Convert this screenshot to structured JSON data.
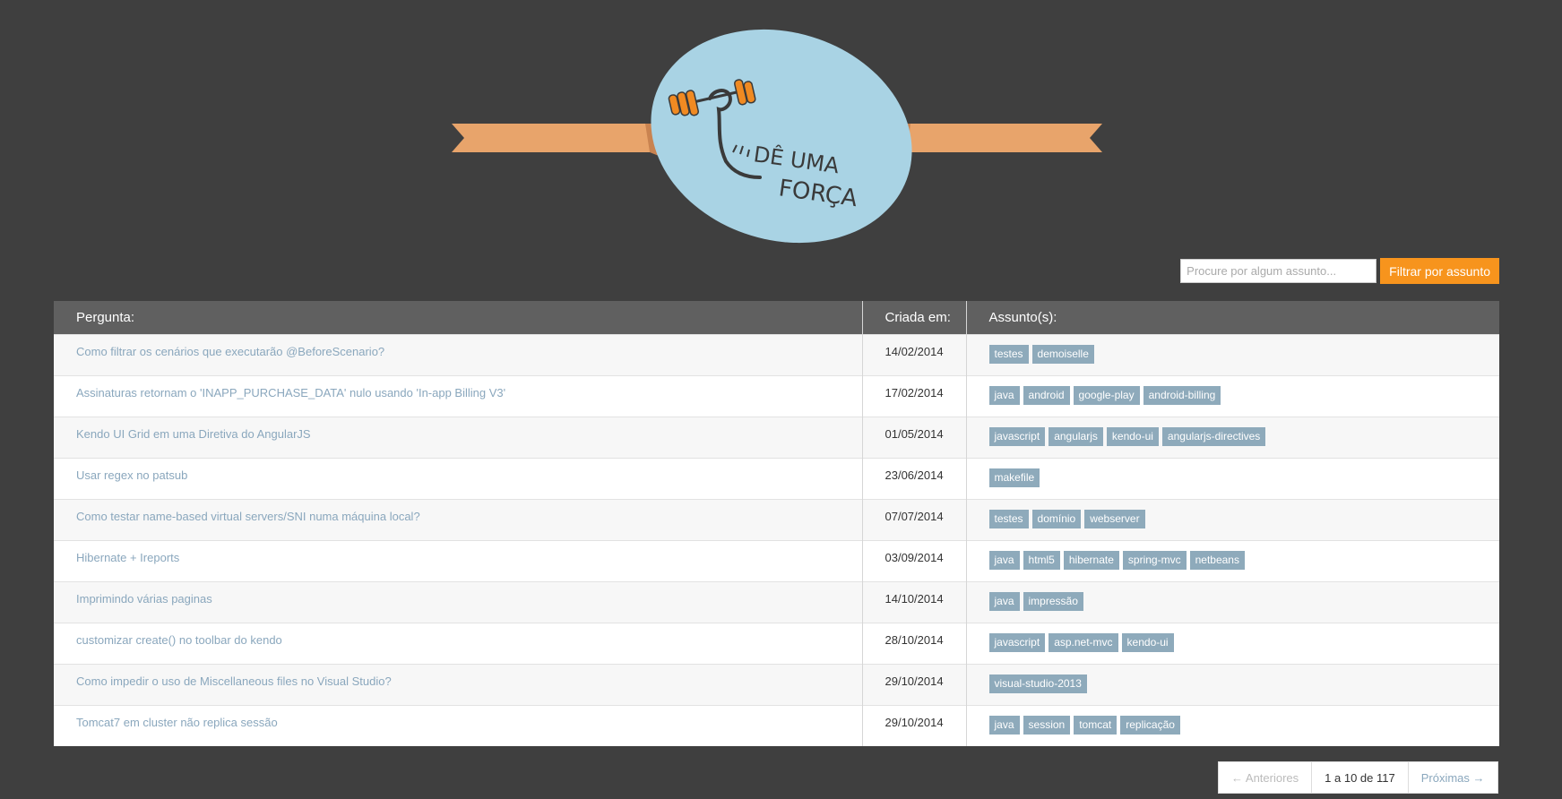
{
  "logo": {
    "text_line1": "DÊ UMA",
    "text_line2": "FORÇA"
  },
  "search": {
    "placeholder": "Procure por algum assunto...",
    "value": "",
    "button_label": "Filtrar por assunto"
  },
  "table": {
    "headers": {
      "question": "Pergunta:",
      "created": "Criada em:",
      "subjects": "Assunto(s):"
    },
    "rows": [
      {
        "title": "Como filtrar os cenários que executarão @BeforeScenario?",
        "date": "14/02/2014",
        "tags": [
          "testes",
          "demoiselle"
        ]
      },
      {
        "title": "Assinaturas retornam o 'INAPP_PURCHASE_DATA' nulo usando 'In-app Billing V3'",
        "date": "17/02/2014",
        "tags": [
          "java",
          "android",
          "google-play",
          "android-billing"
        ]
      },
      {
        "title": "Kendo UI Grid em uma Diretiva do AngularJS",
        "date": "01/05/2014",
        "tags": [
          "javascript",
          "angularjs",
          "kendo-ui",
          "angularjs-directives"
        ]
      },
      {
        "title": "Usar regex no patsub",
        "date": "23/06/2014",
        "tags": [
          "makefile"
        ]
      },
      {
        "title": "Como testar name-based virtual servers/SNI numa máquina local?",
        "date": "07/07/2014",
        "tags": [
          "testes",
          "domínio",
          "webserver"
        ]
      },
      {
        "title": "Hibernate + Ireports",
        "date": "03/09/2014",
        "tags": [
          "java",
          "html5",
          "hibernate",
          "spring-mvc",
          "netbeans"
        ]
      },
      {
        "title": "Imprimindo várias paginas",
        "date": "14/10/2014",
        "tags": [
          "java",
          "impressão"
        ]
      },
      {
        "title": "customizar create() no toolbar do kendo",
        "date": "28/10/2014",
        "tags": [
          "javascript",
          "asp.net-mvc",
          "kendo-ui"
        ]
      },
      {
        "title": "Como impedir o uso de Miscellaneous files no Visual Studio?",
        "date": "29/10/2014",
        "tags": [
          "visual-studio-2013"
        ]
      },
      {
        "title": "Tomcat7 em cluster não replica sessão",
        "date": "29/10/2014",
        "tags": [
          "java",
          "session",
          "tomcat",
          "replicação"
        ]
      }
    ]
  },
  "pagination": {
    "prev_label": "← Anteriores",
    "info": "1 a 10 de 117",
    "next_label": "Próximas →"
  },
  "colors": {
    "background": "#3f3f3f",
    "accent": "#f7941d",
    "link": "#8aa7bd",
    "tag": "#8eaabb",
    "header": "#606060",
    "logo_blue": "#a9d3e4",
    "ribbon": "#e8a46b"
  },
  "icons": {
    "logo": "dumbbell-arm-icon"
  }
}
